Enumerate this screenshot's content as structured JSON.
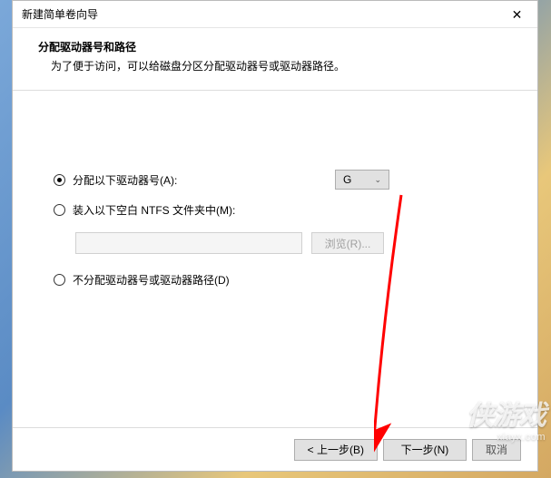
{
  "window": {
    "title": "新建简单卷向导",
    "close": "✕"
  },
  "header": {
    "title": "分配驱动器号和路径",
    "description": "为了便于访问，可以给磁盘分区分配驱动器号或驱动器路径。"
  },
  "options": {
    "assign": "分配以下驱动器号(A):",
    "mount": "装入以下空白 NTFS 文件夹中(M):",
    "none": "不分配驱动器号或驱动器路径(D)"
  },
  "drive": {
    "selected": "G"
  },
  "buttons": {
    "browse": "浏览(R)...",
    "back": "< 上一步(B)",
    "next": "下一步(N)",
    "cancel": "取消"
  },
  "watermark": {
    "logo": "侠游戏",
    "url": "xiayx.com"
  }
}
